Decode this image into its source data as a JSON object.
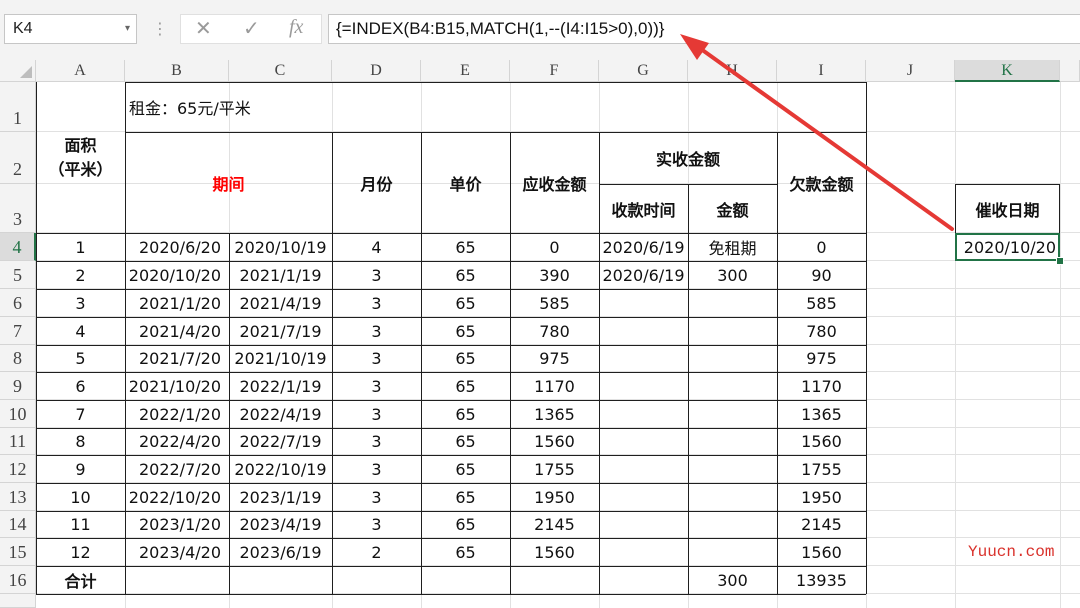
{
  "toolbar": {
    "name_box": "K4",
    "name_box_arrow": "▾",
    "separator": "⋮",
    "cancel_glyph": "✕",
    "enter_glyph": "✓",
    "fx_glyph": "fx",
    "formula": "{=INDEX(B4:B15,MATCH(1,--(I4:I15>0),0))}"
  },
  "columns": [
    "A",
    "B",
    "C",
    "D",
    "E",
    "F",
    "G",
    "H",
    "I",
    "J",
    "K"
  ],
  "selected_column": "K",
  "rows": [
    "1",
    "2",
    "3",
    "4",
    "5",
    "6",
    "7",
    "8",
    "9",
    "10",
    "11",
    "12",
    "13",
    "14",
    "15",
    "16",
    ""
  ],
  "selected_row": "4",
  "sheet": {
    "rent_note": "租金：65元/平米",
    "area_header": "面积\n（平米）",
    "period_header": "期间",
    "month_header": "月份",
    "price_header": "单价",
    "receivable_header": "应收金额",
    "received_header": "实收金额",
    "received_time_header": "收款时间",
    "received_amount_header": "金额",
    "arrears_header": "欠款金额",
    "urge_header": "催收日期",
    "urge_value": "2020/10/20",
    "data_rows": [
      {
        "area": "1",
        "start": "2020/6/20",
        "end": "2020/10/19",
        "months": "4",
        "price": "65",
        "due": "0",
        "paid_date": "2020/6/19",
        "paid_amount": "免租期",
        "owed": "0"
      },
      {
        "area": "2",
        "start": "2020/10/20",
        "end": "2021/1/19",
        "months": "3",
        "price": "65",
        "due": "390",
        "paid_date": "2020/6/19",
        "paid_amount": "300",
        "owed": "90"
      },
      {
        "area": "3",
        "start": "2021/1/20",
        "end": "2021/4/19",
        "months": "3",
        "price": "65",
        "due": "585",
        "paid_date": "",
        "paid_amount": "",
        "owed": "585"
      },
      {
        "area": "4",
        "start": "2021/4/20",
        "end": "2021/7/19",
        "months": "3",
        "price": "65",
        "due": "780",
        "paid_date": "",
        "paid_amount": "",
        "owed": "780"
      },
      {
        "area": "5",
        "start": "2021/7/20",
        "end": "2021/10/19",
        "months": "3",
        "price": "65",
        "due": "975",
        "paid_date": "",
        "paid_amount": "",
        "owed": "975"
      },
      {
        "area": "6",
        "start": "2021/10/20",
        "end": "2022/1/19",
        "months": "3",
        "price": "65",
        "due": "1170",
        "paid_date": "",
        "paid_amount": "",
        "owed": "1170"
      },
      {
        "area": "7",
        "start": "2022/1/20",
        "end": "2022/4/19",
        "months": "3",
        "price": "65",
        "due": "1365",
        "paid_date": "",
        "paid_amount": "",
        "owed": "1365"
      },
      {
        "area": "8",
        "start": "2022/4/20",
        "end": "2022/7/19",
        "months": "3",
        "price": "65",
        "due": "1560",
        "paid_date": "",
        "paid_amount": "",
        "owed": "1560"
      },
      {
        "area": "9",
        "start": "2022/7/20",
        "end": "2022/10/19",
        "months": "3",
        "price": "65",
        "due": "1755",
        "paid_date": "",
        "paid_amount": "",
        "owed": "1755"
      },
      {
        "area": "10",
        "start": "2022/10/20",
        "end": "2023/1/19",
        "months": "3",
        "price": "65",
        "due": "1950",
        "paid_date": "",
        "paid_amount": "",
        "owed": "1950"
      },
      {
        "area": "11",
        "start": "2023/1/20",
        "end": "2023/4/19",
        "months": "3",
        "price": "65",
        "due": "2145",
        "paid_date": "",
        "paid_amount": "",
        "owed": "2145"
      },
      {
        "area": "12",
        "start": "2023/4/20",
        "end": "2023/6/19",
        "months": "2",
        "price": "65",
        "due": "1560",
        "paid_date": "",
        "paid_amount": "",
        "owed": "1560"
      }
    ],
    "total_label": "合计",
    "total_paid": "300",
    "total_owed": "13935"
  },
  "watermark": "Yuucn.com",
  "colors": {
    "accent": "#217346",
    "period_text": "#ff0000",
    "arrow": "#e53935",
    "watermark": "#d9312b"
  }
}
